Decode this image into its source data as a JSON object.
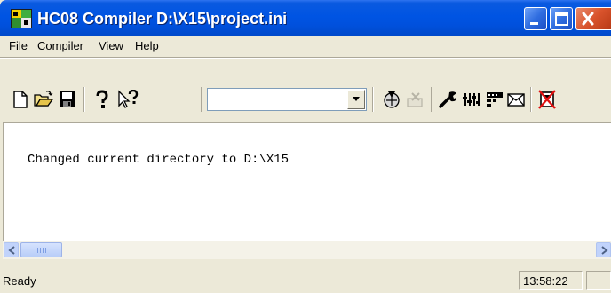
{
  "window": {
    "title": "HC08 Compiler  D:\\X15\\project.ini"
  },
  "menu": {
    "items": [
      {
        "label": "File"
      },
      {
        "label": "Compiler"
      },
      {
        "label": "View"
      },
      {
        "label": "Help"
      }
    ]
  },
  "toolbar": {
    "combo_value": "",
    "icons": [
      "new-file-icon",
      "open-folder-icon",
      "save-icon",
      "help-icon",
      "context-help-icon",
      "compile-icon",
      "delete-icon",
      "options-wrench-icon",
      "smart-slider-icon",
      "messages-icon",
      "mail-icon",
      "stop-icon"
    ]
  },
  "output": {
    "lines": [
      "Changed current directory to D:\\X15"
    ]
  },
  "status": {
    "text": "Ready",
    "time": "13:58:22"
  },
  "colors": {
    "titlebar": "#0054e3",
    "close_button": "#d9532c",
    "window_bg": "#ece9d8",
    "client_bg": "#ffffff"
  }
}
